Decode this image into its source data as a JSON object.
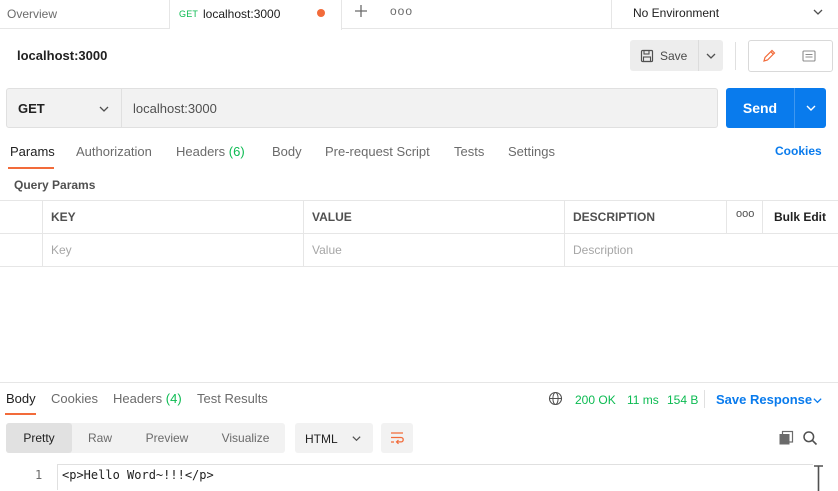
{
  "tabs": {
    "overview_label": "Overview",
    "active_method": "GET",
    "active_label": "localhost:3000",
    "more_label": "ooo"
  },
  "environment": {
    "label": "No Environment"
  },
  "request": {
    "title": "localhost:3000",
    "save_label": "Save",
    "method": "GET",
    "url": "localhost:3000",
    "send_label": "Send"
  },
  "request_tabs": [
    {
      "label": "Params"
    },
    {
      "label": "Authorization"
    },
    {
      "label": "Headers",
      "count": "(6)"
    },
    {
      "label": "Body"
    },
    {
      "label": "Pre-request Script"
    },
    {
      "label": "Tests"
    },
    {
      "label": "Settings"
    }
  ],
  "cookies_label": "Cookies",
  "query_params": {
    "section_label": "Query Params",
    "columns": [
      "KEY",
      "VALUE",
      "DESCRIPTION"
    ],
    "more_label": "ooo",
    "bulk_edit_label": "Bulk Edit",
    "placeholders": [
      "Key",
      "Value",
      "Description"
    ]
  },
  "response": {
    "tabs": [
      {
        "label": "Body"
      },
      {
        "label": "Cookies"
      },
      {
        "label": "Headers",
        "count": "(4)"
      },
      {
        "label": "Test Results"
      }
    ],
    "status": "200 OK",
    "time": "11 ms",
    "size": "154 B",
    "save_response_label": "Save Response",
    "view_modes": [
      "Pretty",
      "Raw",
      "Preview",
      "Visualize"
    ],
    "language": "HTML",
    "line_number": "1",
    "code": "<p>Hello Word~!!!</p>"
  },
  "colors": {
    "accent": "#097bed",
    "success": "#0cbb52",
    "active_tab": "#f26b3a"
  }
}
